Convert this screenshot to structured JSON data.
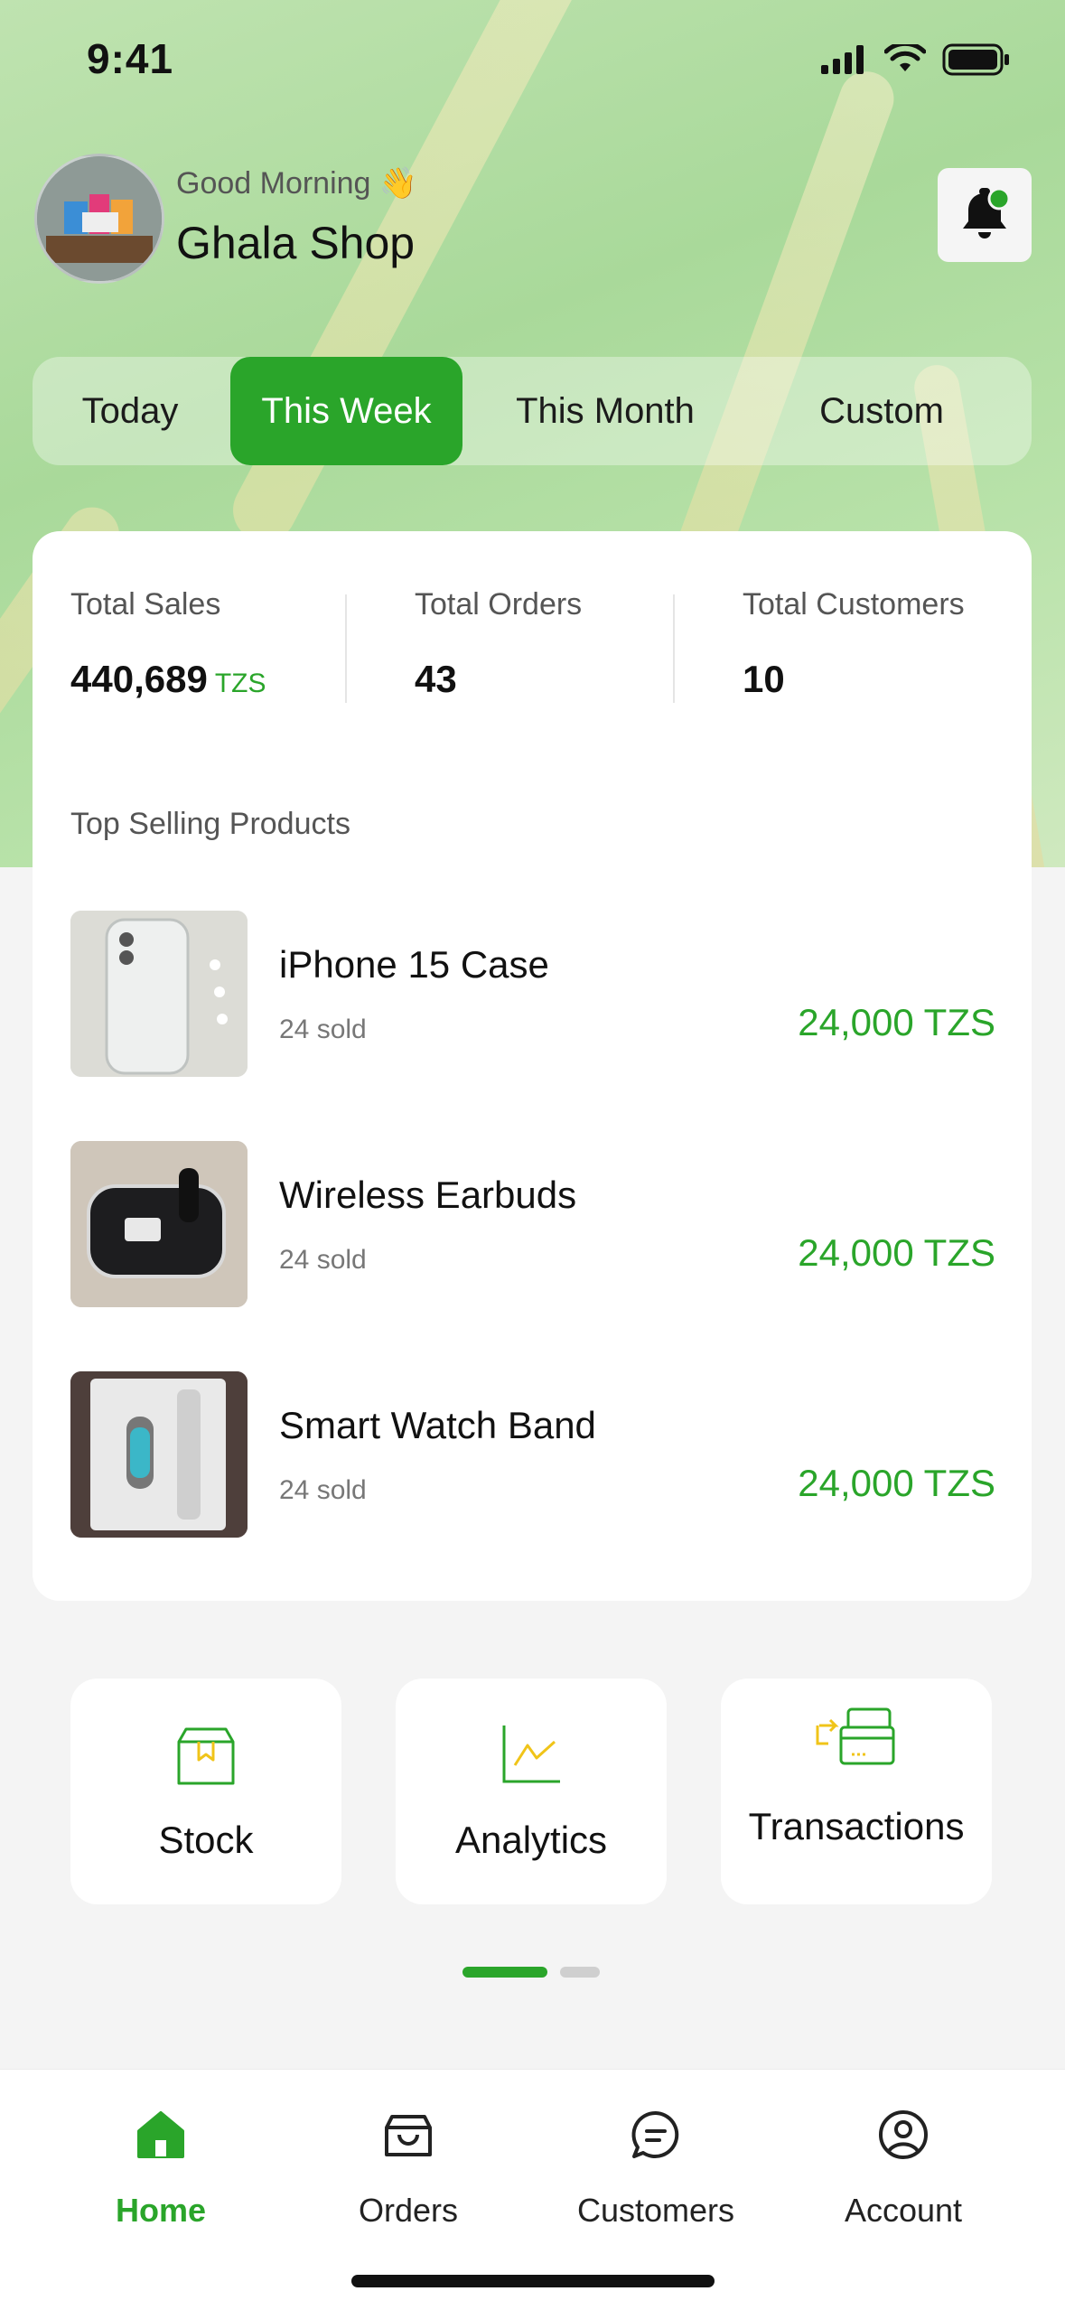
{
  "status": {
    "time": "9:41"
  },
  "header": {
    "greeting": "Good Morning 👋",
    "shop_name": "Ghala Shop"
  },
  "tabs": [
    {
      "label": "Today",
      "active": false
    },
    {
      "label": "This Week",
      "active": true
    },
    {
      "label": "This Month",
      "active": false
    },
    {
      "label": "Custom",
      "active": false
    }
  ],
  "stats": [
    {
      "label": "Total Sales",
      "value": "440,689",
      "unit": "TZS"
    },
    {
      "label": "Total Orders",
      "value": "43"
    },
    {
      "label": "Total Customers",
      "value": "10"
    }
  ],
  "top_products": {
    "title": "Top Selling Products",
    "items": [
      {
        "name": "iPhone 15 Case",
        "sold": "24 sold",
        "price": "24,000 TZS"
      },
      {
        "name": "Wireless Earbuds",
        "sold": "24 sold",
        "price": "24,000 TZS"
      },
      {
        "name": "Smart Watch Band",
        "sold": "24 sold",
        "price": "24,000 TZS"
      }
    ]
  },
  "quick_actions": [
    {
      "label": "Stock",
      "icon": "box-icon"
    },
    {
      "label": "Analytics",
      "icon": "chart-icon"
    },
    {
      "label": "Transactions",
      "icon": "transactions-icon"
    }
  ],
  "pager": {
    "pages": 2,
    "active_index": 0
  },
  "bottom_nav": [
    {
      "label": "Home",
      "icon": "home-icon",
      "active": true
    },
    {
      "label": "Orders",
      "icon": "bag-icon",
      "active": false
    },
    {
      "label": "Customers",
      "icon": "chat-icon",
      "active": false
    },
    {
      "label": "Account",
      "icon": "user-circle-icon",
      "active": false
    }
  ],
  "colors": {
    "accent": "#2aa52a",
    "notification_dot": "#2aa52a",
    "chart_line": "#f0c419"
  }
}
